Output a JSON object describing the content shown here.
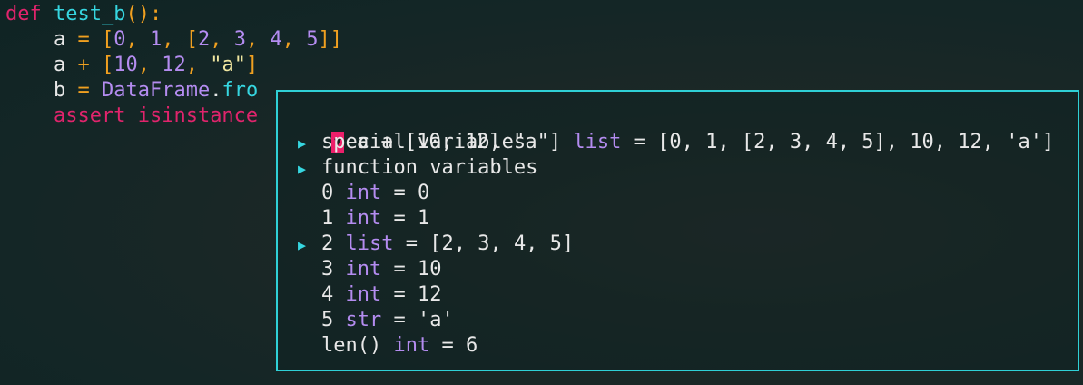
{
  "code": {
    "line1": {
      "def": "def",
      "name": "test_b",
      "paren": "():"
    },
    "line2": {
      "var": "a",
      "eq": "=",
      "open": "[",
      "n0": "0",
      "c1": ",",
      "n1": "1",
      "c2": ",",
      "open2": "[",
      "n2": "2",
      "c3": ",",
      "n3": "3",
      "c4": ",",
      "n4": "4",
      "c5": ",",
      "n5": "5",
      "close": "]]"
    },
    "line3": {
      "var": "a",
      "op": "+",
      "open": "[",
      "n10": "10",
      "c1": ",",
      "n12": "12",
      "c2": ",",
      "s": "\"a\"",
      "close": "]"
    },
    "line4": {
      "var": "b",
      "eq": "=",
      "cls": "DataFrame",
      "dot": ".",
      "method": "fro"
    },
    "line5": {
      "assert": "assert",
      "fn": "isinstance"
    }
  },
  "debug_popup": {
    "header": {
      "expr": "a + [10, 12, \"a\"]",
      "type": "list",
      "value": "= [0, 1, [2, 3, 4, 5], 10, 12, 'a']"
    },
    "rows": [
      {
        "label": "special variables",
        "type": "",
        "value": "",
        "expandable": true
      },
      {
        "label": "function variables",
        "type": "",
        "value": "",
        "expandable": true
      },
      {
        "label": "0",
        "type": "int",
        "value": "= 0",
        "expandable": false
      },
      {
        "label": "1",
        "type": "int",
        "value": "= 1",
        "expandable": false
      },
      {
        "label": "2",
        "type": "list",
        "value": "= [2, 3, 4, 5]",
        "expandable": true
      },
      {
        "label": "3",
        "type": "int",
        "value": "= 10",
        "expandable": false
      },
      {
        "label": "4",
        "type": "int",
        "value": "= 12",
        "expandable": false
      },
      {
        "label": "5",
        "type": "str",
        "value": "= 'a'",
        "expandable": false
      },
      {
        "label": "len()",
        "type": "int",
        "value": "= 6",
        "expandable": false
      }
    ],
    "expand_glyph": "▶",
    "collapse_glyph": "▼"
  },
  "colors": {
    "accent_border": "#2fd0d6",
    "keyword": "#e0246c",
    "type": "#b48cf0",
    "selection": "#ec1f6a"
  }
}
